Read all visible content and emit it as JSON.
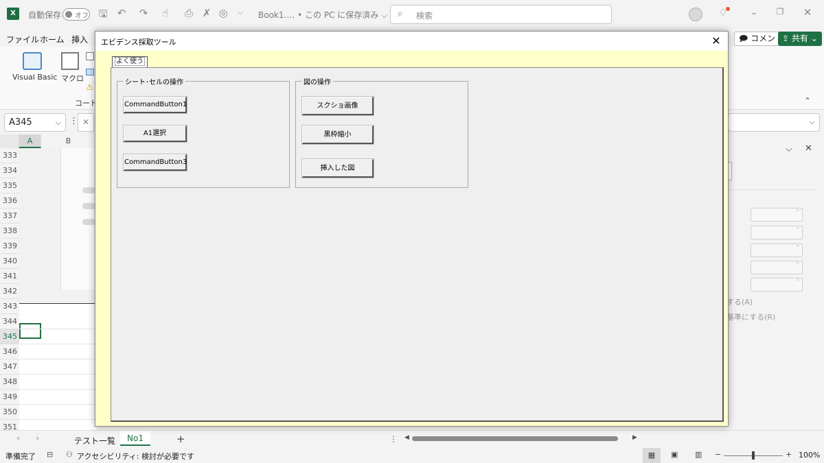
{
  "titlebar": {
    "autosave_label": "自動保存",
    "autosave_state": "オフ",
    "doc_title": "Book1.… • この PC に保存済み ⌵",
    "search_placeholder": "検索"
  },
  "menu": {
    "items": [
      "ファイル",
      "ホーム",
      "挿入"
    ]
  },
  "ribbon": {
    "visual_basic": "Visual Basic",
    "macro": "マクロ",
    "group_code": "コード",
    "comment_button": "コメント",
    "share_button": "共有"
  },
  "formula_bar": {
    "name_box": "A345"
  },
  "grid": {
    "columns": [
      "A",
      "B"
    ],
    "rows": [
      "333",
      "334",
      "335",
      "336",
      "337",
      "338",
      "339",
      "340",
      "341",
      "342",
      "343",
      "344",
      "345",
      "346",
      "347",
      "348",
      "349",
      "350",
      "351"
    ],
    "selected_row": "345",
    "selected_cell": "A345"
  },
  "right_pane": {
    "link_a": "する(A)",
    "link_r": "基準にする(R)"
  },
  "sheet_tabs": {
    "tabs": [
      "テスト一覧",
      "No1"
    ],
    "active": "No1",
    "add": "+"
  },
  "status_bar": {
    "ready": "準備完了",
    "accessibility": "アクセシビリティ: 検討が必要です",
    "zoom": "100%"
  },
  "dialog": {
    "title": "エビデンス採取ツール",
    "tab": "よく使う",
    "frame1": {
      "caption": "シート･セルの操作",
      "buttons": [
        "CommandButton1",
        "A1選択",
        "CommandButton3"
      ]
    },
    "frame2": {
      "caption": "図の操作",
      "buttons": [
        "スクショ画像",
        "黒枠縮小",
        "挿入した図"
      ]
    }
  },
  "colors": {
    "excel_green": "#1e7145",
    "dialog_bg": "#ffffc9",
    "control_face": "#efefef"
  }
}
